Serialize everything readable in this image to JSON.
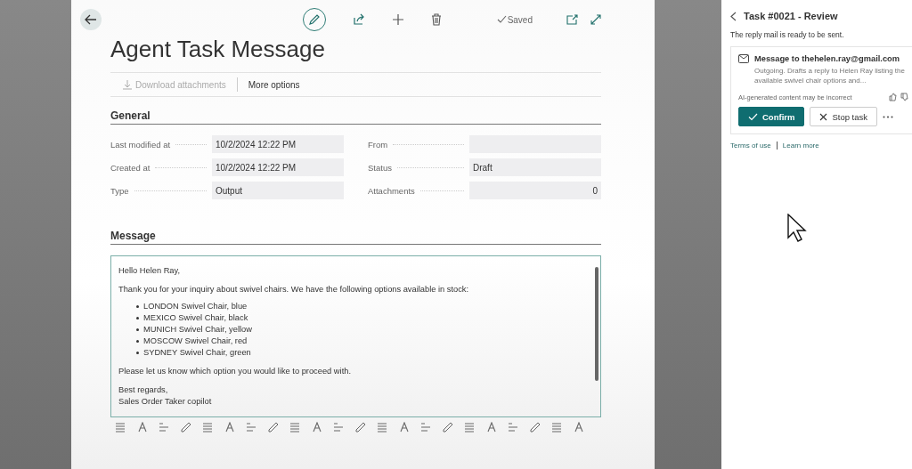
{
  "dialog": {
    "edit_mode": true,
    "save_state": "Saved",
    "title": "Agent Task Message",
    "actions": [
      {
        "label": "Download attachments",
        "disabled": true,
        "kind": "download"
      },
      {
        "label": "More options",
        "disabled": false,
        "kind": "plain"
      }
    ],
    "general": {
      "heading": "General",
      "fields": [
        {
          "label": "Last modified at",
          "value": "10/2/2024 12:22 PM",
          "kind": "text"
        },
        {
          "label": "From",
          "kind": "text"
        },
        {
          "label": "Created at",
          "value": "10/2/2024 12:22 PM",
          "kind": "text"
        },
        {
          "label": "Status",
          "value": "Draft",
          "kind": "text"
        },
        {
          "label": "Type",
          "value": "Output",
          "kind": "text"
        },
        {
          "label": "Attachments",
          "value": "0",
          "kind": "number"
        }
      ]
    },
    "message": {
      "heading": "Message",
      "blocks": [
        {
          "kind": "text",
          "lines": [
            "Hello Helen Ray,"
          ]
        },
        {
          "kind": "text",
          "lines": [
            "Thank you for your inquiry about swivel chairs. We have the following options available in stock:"
          ]
        },
        {
          "kind": "list",
          "lines": [
            "LONDON Swivel Chair, blue",
            "MEXICO Swivel Chair, black",
            "MUNICH Swivel Chair, yellow",
            "MOSCOW Swivel Chair, red",
            "SYDNEY Swivel Chair, green"
          ]
        },
        {
          "kind": "text",
          "lines": [
            "Please let us know which option you would like to proceed with."
          ]
        },
        {
          "kind": "text",
          "lines": [
            "Best regards,",
            "Sales Order Taker copilot"
          ]
        }
      ]
    }
  },
  "pane": {
    "title": "Task #0021 - Review",
    "status": "The reply mail is ready to be sent.",
    "card": {
      "title": "Message to thehelen.ray@gmail.com",
      "description": "Outgoing. Drafts a reply to Helen Ray listing the available swivel chair options and...",
      "disclaimer": "AI-generated content may be incorrect",
      "buttons": [
        {
          "label": "Confirm",
          "kind": "primary"
        },
        {
          "label": "Stop task",
          "kind": "secondary"
        }
      ]
    },
    "links": [
      "Terms of use",
      "Learn more"
    ]
  }
}
